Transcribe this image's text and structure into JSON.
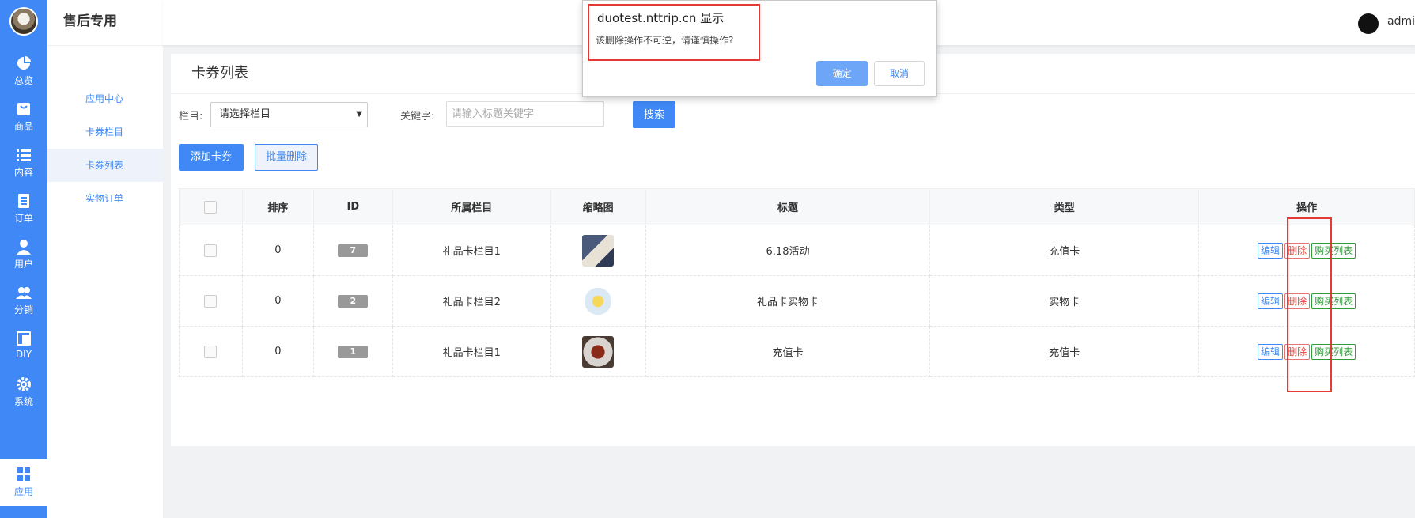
{
  "app": {
    "brand": "售后专用",
    "username": "admi"
  },
  "rail": [
    {
      "label": "总览",
      "icon": "pie-chart-icon"
    },
    {
      "label": "商品",
      "icon": "shopping-bag-icon"
    },
    {
      "label": "内容",
      "icon": "list-icon"
    },
    {
      "label": "订单",
      "icon": "document-icon"
    },
    {
      "label": "用户",
      "icon": "user-icon"
    },
    {
      "label": "分销",
      "icon": "users-icon"
    },
    {
      "label": "DIY",
      "icon": "layout-icon"
    },
    {
      "label": "系统",
      "icon": "gear-icon"
    },
    {
      "label": "应用",
      "icon": "grid-icon"
    }
  ],
  "subnav": {
    "items": [
      "应用中心",
      "卡券栏目",
      "卡券列表",
      "实物订单"
    ]
  },
  "page": {
    "title": "卡券列表"
  },
  "filter": {
    "category_label": "栏目:",
    "category_value": "请选择栏目",
    "keyword_label": "关键字:",
    "keyword_placeholder": "请输入标题关键字",
    "search_label": "搜索"
  },
  "actions": {
    "add_label": "添加卡券",
    "batch_delete_label": "批量删除"
  },
  "table": {
    "headers": [
      "排序",
      "ID",
      "所属栏目",
      "缩略图",
      "标题",
      "类型",
      "操作"
    ],
    "rows": [
      {
        "sort": "0",
        "id": "7",
        "category": "礼品卡栏目1",
        "title": "6.18活动",
        "type": "充值卡"
      },
      {
        "sort": "0",
        "id": "2",
        "category": "礼品卡栏目2",
        "title": "礼品卡实物卡",
        "type": "实物卡"
      },
      {
        "sort": "0",
        "id": "1",
        "category": "礼品卡栏目1",
        "title": "充值卡",
        "type": "充值卡"
      }
    ],
    "row_actions": {
      "edit": "编辑",
      "delete": "删除",
      "buy_list": "购买列表"
    }
  },
  "dialog": {
    "title": "duotest.nttrip.cn 显示",
    "message": "该删除操作不可逆，请谨慎操作?",
    "ok": "确定",
    "cancel": "取消"
  },
  "colors": {
    "primary": "#3f88f5",
    "danger": "#e53935",
    "success": "#2e9d3a"
  }
}
